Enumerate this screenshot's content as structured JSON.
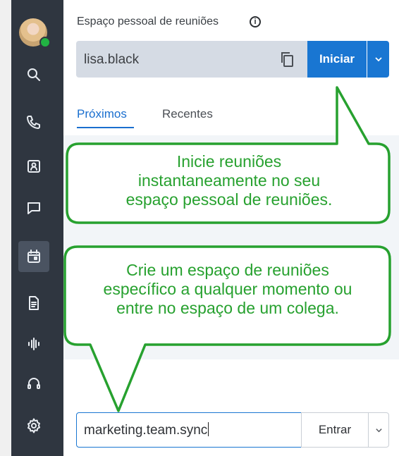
{
  "sidebar": {
    "user": {
      "presence": "online"
    },
    "items": [
      {
        "name": "search",
        "icon": "search-icon"
      },
      {
        "name": "calls",
        "icon": "phone-icon"
      },
      {
        "name": "contacts",
        "icon": "contact-card-icon"
      },
      {
        "name": "messaging",
        "icon": "chat-bubble-icon"
      },
      {
        "name": "meetings",
        "icon": "calendar-icon",
        "active": true
      },
      {
        "name": "files",
        "icon": "document-icon"
      },
      {
        "name": "voicemail",
        "icon": "audio-wave-icon"
      },
      {
        "name": "support",
        "icon": "headset-icon"
      },
      {
        "name": "settings",
        "icon": "gear-icon"
      }
    ]
  },
  "pmr": {
    "label": "Espaço pessoal de reuniões",
    "value": "lisa.black",
    "start_label": "Iniciar"
  },
  "tabs": {
    "upcoming": "Próximos",
    "recent": "Recentes"
  },
  "join": {
    "value": "marketing.team.sync",
    "button_label": "Entrar"
  },
  "callouts": {
    "first": [
      "Inicie reuniões",
      "instantaneamente no seu",
      "espaço pessoal de reuniões."
    ],
    "second": [
      "Crie um espaço de reuniões",
      "específico a qualquer momento ou",
      "entre no espaço de um colega."
    ]
  },
  "colors": {
    "sidebar": "#2f3640",
    "accent": "#1976d2",
    "callout": "#27a12f"
  }
}
